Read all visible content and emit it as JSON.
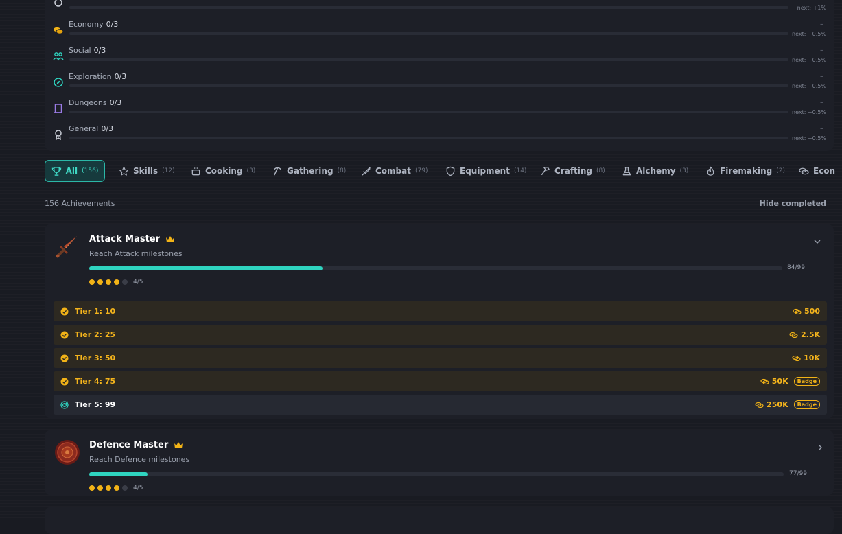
{
  "categories": [
    {
      "name": "",
      "count": "",
      "dash": "",
      "next": "next: +1%",
      "icon": "skills-icon"
    },
    {
      "name": "Economy",
      "count": "0/3",
      "dash": "–",
      "next": "next: +0.5%",
      "icon": "coins-icon"
    },
    {
      "name": "Social",
      "count": "0/3",
      "dash": "–",
      "next": "next: +0.5%",
      "icon": "people-icon"
    },
    {
      "name": "Exploration",
      "count": "0/3",
      "dash": "–",
      "next": "next: +0.5%",
      "icon": "compass-icon"
    },
    {
      "name": "Dungeons",
      "count": "0/3",
      "dash": "–",
      "next": "next: +0.5%",
      "icon": "door-icon"
    },
    {
      "name": "General",
      "count": "0/3",
      "dash": "–",
      "next": "next: +0.5%",
      "icon": "medal-icon"
    }
  ],
  "tabs": [
    {
      "label": "All",
      "count": "(156)",
      "icon": "trophy-icon",
      "active": true
    },
    {
      "label": "Skills",
      "count": "(12)",
      "icon": "star-icon"
    },
    {
      "label": "Cooking",
      "count": "(3)",
      "icon": "pot-icon"
    },
    {
      "label": "Gathering",
      "count": "(8)",
      "icon": "pickaxe-icon"
    },
    {
      "label": "Combat",
      "count": "(79)",
      "icon": "sword-icon"
    },
    {
      "label": "Equipment",
      "count": "(14)",
      "icon": "shield-icon"
    },
    {
      "label": "Crafting",
      "count": "(8)",
      "icon": "hammer-icon"
    },
    {
      "label": "Alchemy",
      "count": "(3)",
      "icon": "flask-icon"
    },
    {
      "label": "Firemaking",
      "count": "(2)",
      "icon": "flame-icon"
    },
    {
      "label": "Econ",
      "count": "",
      "icon": "coins-icon"
    }
  ],
  "summary": {
    "count_label": "156 Achievements",
    "hide_label": "Hide completed"
  },
  "achievements": [
    {
      "title": "Attack Master",
      "description": "Reach Attack milestones",
      "progress_text": "84/99",
      "progress": 0.3365,
      "tiers_done": 4,
      "tiers_text": "4/5",
      "expanded": true,
      "tiers": [
        {
          "label": "Tier 1: 10",
          "reward": "500",
          "badge": "",
          "done": true
        },
        {
          "label": "Tier 2: 25",
          "reward": "2.5K",
          "badge": "",
          "done": true
        },
        {
          "label": "Tier 3: 50",
          "reward": "10K",
          "badge": "",
          "done": true
        },
        {
          "label": "Tier 4: 75",
          "reward": "50K",
          "badge": "Badge",
          "done": true
        },
        {
          "label": "Tier 5: 99",
          "reward": "250K",
          "badge": "Badge",
          "done": false
        }
      ]
    },
    {
      "title": "Defence Master",
      "description": "Reach Defence milestones",
      "progress_text": "77/99",
      "progress": 0.0837,
      "tiers_done": 4,
      "tiers_text": "4/5",
      "expanded": false
    }
  ],
  "colors": {
    "accent": "#2fd4c0",
    "gold": "#f2b317",
    "background": "#191b22"
  }
}
